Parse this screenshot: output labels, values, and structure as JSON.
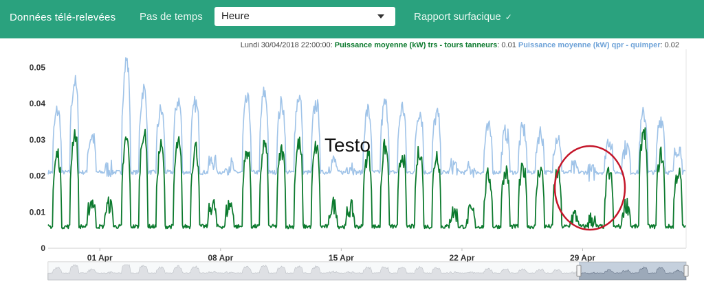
{
  "toolbar": {
    "title": "Données télé-relevées",
    "timestep_label": "Pas de temps",
    "timestep_value": "Heure",
    "report_label": "Rapport surfacique",
    "report_icon": "check-icon"
  },
  "chart": {
    "legend_date": "Lundi 30/04/2018 22:00:00: ",
    "series1_label": "Puissance moyenne (kW) trs - tours tanneurs",
    "series1_value": ": 0.01 ",
    "series2_label": "Puissance moyenne (kW) qpr - quimper",
    "series2_value": ": 0.02",
    "overlay_text": "Testo",
    "colors": {
      "series1": "#0c7a2e",
      "series2": "#9fc3e8",
      "annotation": "#c4162a",
      "header": "#2aa27e"
    }
  },
  "chart_data": {
    "type": "line",
    "x_start": "2018-03-29",
    "x_end": "2018-05-04",
    "x_ticks": [
      "01 Apr",
      "08 Apr",
      "15 Apr",
      "22 Apr",
      "29 Apr"
    ],
    "y_ticks": [
      "0",
      "0.01",
      "0.02",
      "0.03",
      "0.04",
      "0.05"
    ],
    "ylim": [
      0,
      0.055
    ],
    "series": [
      {
        "name": "Puissance moyenne (kW) trs - tours tanneurs",
        "color": "#0c7a2e",
        "baseline": 0.006,
        "daily_peaks": [
          0.026,
          0.032,
          0.013,
          0.012,
          0.03,
          0.032,
          0.028,
          0.029,
          0.028,
          0.012,
          0.012,
          0.027,
          0.029,
          0.027,
          0.029,
          0.028,
          0.012,
          0.011,
          0.026,
          0.028,
          0.026,
          0.027,
          0.026,
          0.01,
          0.01,
          0.02,
          0.021,
          0.022,
          0.022,
          0.021,
          0.009,
          0.008,
          0.021,
          0.012,
          0.033,
          0.026,
          0.021
        ]
      },
      {
        "name": "Puissance moyenne (kW) qpr - quimper",
        "color": "#9fc3e8",
        "baseline": 0.021,
        "daily_peaks": [
          0.038,
          0.046,
          0.031,
          0.022,
          0.052,
          0.044,
          0.038,
          0.041,
          0.04,
          0.024,
          0.023,
          0.041,
          0.043,
          0.04,
          0.042,
          0.04,
          0.024,
          0.023,
          0.038,
          0.04,
          0.039,
          0.038,
          0.037,
          0.023,
          0.022,
          0.033,
          0.032,
          0.033,
          0.032,
          0.031,
          0.022,
          0.021,
          0.03,
          0.028,
          0.037,
          0.036,
          0.028
        ]
      }
    ],
    "annotation": {
      "type": "ellipse",
      "around": "29 Apr"
    }
  }
}
